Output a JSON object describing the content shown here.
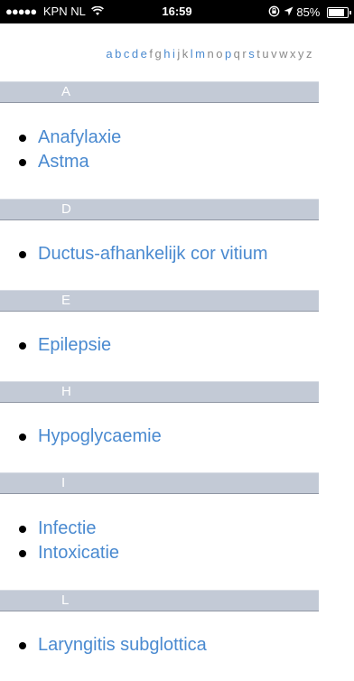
{
  "status_bar": {
    "signal_dots": "●●●●●",
    "carrier": "KPN NL",
    "wifi_icon": "wifi-icon",
    "time": "16:59",
    "lock_icon": "rotation-lock-icon",
    "location_icon": "location-arrow-icon",
    "battery_text": "85%",
    "battery_level": 0.85
  },
  "alphabet": [
    {
      "letter": "a",
      "active": true
    },
    {
      "letter": "b",
      "active": true
    },
    {
      "letter": "c",
      "active": true
    },
    {
      "letter": "d",
      "active": true
    },
    {
      "letter": "e",
      "active": true
    },
    {
      "letter": "f",
      "active": false
    },
    {
      "letter": "g",
      "active": false
    },
    {
      "letter": "h",
      "active": true
    },
    {
      "letter": "i",
      "active": true
    },
    {
      "letter": "j",
      "active": false
    },
    {
      "letter": "k",
      "active": false
    },
    {
      "letter": "l",
      "active": true
    },
    {
      "letter": "m",
      "active": true
    },
    {
      "letter": "n",
      "active": false
    },
    {
      "letter": "o",
      "active": false
    },
    {
      "letter": "p",
      "active": true
    },
    {
      "letter": "q",
      "active": false
    },
    {
      "letter": "r",
      "active": false
    },
    {
      "letter": "s",
      "active": true
    },
    {
      "letter": "t",
      "active": false
    },
    {
      "letter": "u",
      "active": false
    },
    {
      "letter": "v",
      "active": false
    },
    {
      "letter": "w",
      "active": false
    },
    {
      "letter": "x",
      "active": false
    },
    {
      "letter": "y",
      "active": false
    },
    {
      "letter": "z",
      "active": false
    }
  ],
  "sections": [
    {
      "letter": "A",
      "items": [
        "Anafylaxie",
        "Astma"
      ]
    },
    {
      "letter": "D",
      "items": [
        "Ductus-afhankelijk cor vitium"
      ]
    },
    {
      "letter": "E",
      "items": [
        "Epilepsie"
      ]
    },
    {
      "letter": "H",
      "items": [
        "Hypoglycaemie"
      ]
    },
    {
      "letter": "I",
      "items": [
        "Infectie",
        "Intoxicatie"
      ]
    },
    {
      "letter": "L",
      "items": [
        "Laryngitis subglottica"
      ]
    }
  ],
  "colors": {
    "link": "#4a8ad0",
    "section_header_bg": "#c3cad6",
    "alphabet_inactive": "#8a8a8a"
  }
}
